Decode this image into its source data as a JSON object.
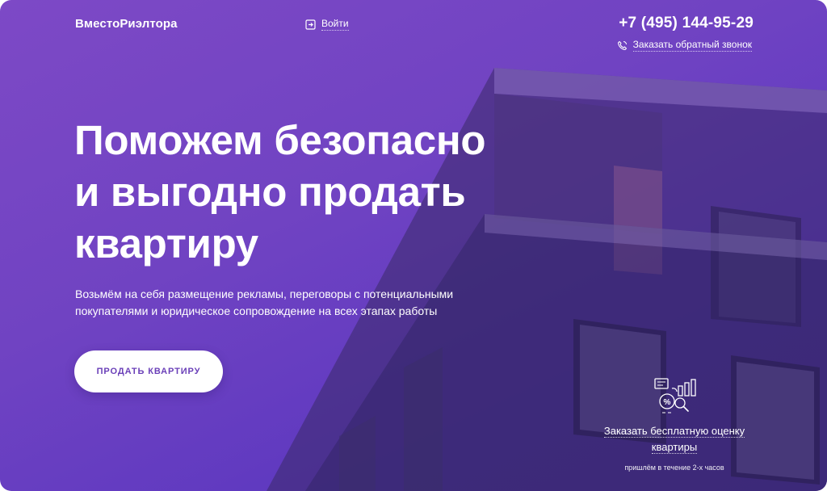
{
  "header": {
    "logo": "ВместоРиэлтора",
    "login_label": "Войти",
    "phone": "+7 (495) 144-95-29",
    "callback_label": "Заказать обратный звонок"
  },
  "hero": {
    "headline": [
      "Поможем безопасно",
      "и выгодно продать",
      "квартиру"
    ],
    "subtitle": "Возьмём на себя размещение рекламы, переговоры с потенциальными покупателями и юридическое сопровождение на всех этапах работы",
    "cta_label": "ПРОДАТЬ КВАРТИРУ"
  },
  "evaluation": {
    "link_label": "Заказать бесплатную оценку квартиры",
    "note": "пришлём в течение 2-х часов",
    "icon": "evaluation-chart-icon"
  },
  "colors": {
    "accent": "#7043c2",
    "cta_text": "#6a3fb8",
    "text": "#ffffff"
  }
}
